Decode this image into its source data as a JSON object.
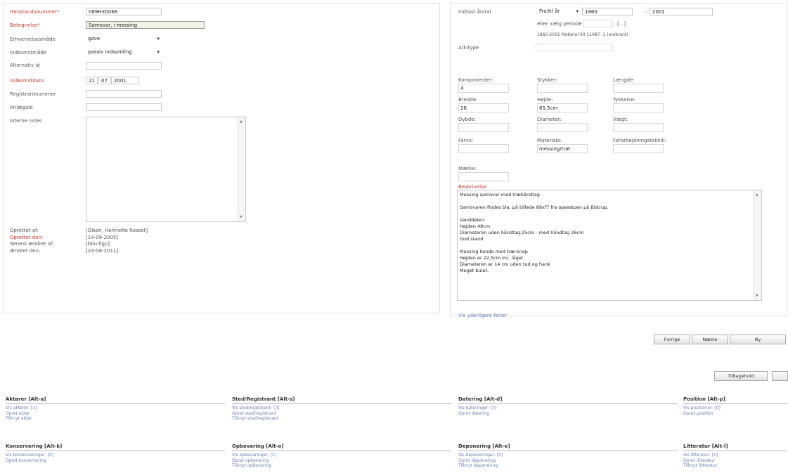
{
  "left": {
    "fields": {
      "genstandsnummer": {
        "label": "Genstandsnummer*",
        "value": "089HX0068"
      },
      "betegnelse": {
        "label": "Betegnelse*",
        "value": "Samovar, i messing"
      },
      "erhvervelsesmade": {
        "label": "Erhvervelsesmåde",
        "value": "gave"
      },
      "indkomstmade": {
        "label": "Indkomstmåde",
        "value": "passiv indsamling"
      },
      "alternativ_id": {
        "label": "Alternativ id",
        "value": ""
      },
      "indkomstdato": {
        "label": "Indkomstdato",
        "day": "21",
        "month": "07",
        "year": "2001"
      },
      "registrantnummer": {
        "label": "Registrantnummer",
        "value": ""
      },
      "anlaegsid": {
        "label": "Anlægsid",
        "value": ""
      },
      "interne_noter": {
        "label": "Interne noter",
        "value": ""
      }
    },
    "meta": [
      {
        "label": "Oprettet af:",
        "value": "[Olsen, Henriette Rosset]",
        "required": false
      },
      {
        "label": "Oprettet den:",
        "value": "[14-09-2005]",
        "required": true
      },
      {
        "label": "Senest ændret af:",
        "value": "[bbu-llgo]",
        "required": false
      },
      {
        "label": "Ændret den:",
        "value": "[24-08-2011]",
        "required": false
      }
    ]
  },
  "right": {
    "indtast_arstal": {
      "label": "Indtast årstal",
      "mode": "Fra/til år",
      "from": "1860",
      "to": "2001",
      "period_text": "eller vælg periode",
      "period_link": "[...]",
      "info": "1860-2001 Materiel 00 11087 -1 (ombrant)"
    },
    "arktype_label": "Arkitype",
    "dims": [
      {
        "label": "Komponenter:",
        "value": "4",
        "required": false
      },
      {
        "label": "Stykker:",
        "value": "",
        "required": false
      },
      {
        "label": "Længde:",
        "value": "",
        "required": true
      },
      {
        "label": "Bredde:",
        "value": "26",
        "required": true
      },
      {
        "label": "Højde:",
        "value": "65,5cm",
        "required": true
      },
      {
        "label": "Tykkelse:",
        "value": "",
        "required": false
      },
      {
        "label": "Dybde:",
        "value": "",
        "required": false
      },
      {
        "label": "Diameter:",
        "value": "",
        "required": false
      },
      {
        "label": "Vægt:",
        "value": "",
        "required": false
      },
      {
        "label": "Farve:",
        "value": "",
        "required": false
      },
      {
        "label": "Materiale:",
        "value": "messing/træ",
        "required": true
      },
      {
        "label": "Forarbejdningsteknik:",
        "value": "",
        "required": false
      },
      {
        "label": "Mærke:",
        "value": "",
        "required": false
      }
    ],
    "beskrivelse_label": "Beskrivelse",
    "beskrivelse_lines": [
      "Messing samovar med træhåndtag",
      "",
      "Samovaren findes bla. på billede 89xf7 fra opsestuen på Bistrup.",
      "",
      "Vanddelen:",
      "Højden 48cm",
      "Diameteren uden håndtag:25cm - med håndtag 26cm",
      "God stand",
      "",
      "Messing kande med træ-knop",
      "Højden er 22,5cm inc. låget",
      "Diameteren er 14 cm uden tud og hank",
      "Meget bulet."
    ],
    "vis_felter": "Vis yderligere felter"
  },
  "nav": {
    "forrige": "Forrige",
    "naeste": "Næste",
    "ny": "Ny"
  },
  "tilbud": "Tilbagehold",
  "sections": [
    {
      "title": "Aktører [Alt-a]",
      "links": [
        "Vis aktører- [3]",
        "Opret aktør",
        "Tilknyt aktør"
      ]
    },
    {
      "title": "Sted/Registrant [Alt-s]",
      "links": [
        "Vis sted/registrant- [3]",
        "Opret sted/registrant",
        "Tilknyt sted/registrant"
      ]
    },
    {
      "title": "Datering [Alt-d]",
      "links": [
        "Vis dateringer- [3]",
        "Opret datering"
      ]
    },
    {
      "title": "Position [Alt-p]",
      "links": [
        "Vis positioner- [0]",
        "Opret position"
      ]
    },
    {
      "title": "Konservering [Alt-k]",
      "links": [
        "Vis konserveringer- [0]",
        "Opret konservering"
      ]
    },
    {
      "title": "Opbevaring [Alt-o]",
      "links": [
        "Vis opbevaringer- [3]",
        "Opret opbevaring",
        "Tilknyt opbevaring"
      ]
    },
    {
      "title": "Deponering [Alt-e]",
      "links": [
        "Vis deponeringer- [0]",
        "Opret deponering",
        "Tilknyt deponering"
      ]
    },
    {
      "title": "Litteratur [Alt-l]",
      "links": [
        "Vis litteratur- [0]",
        "Opret litteratur",
        "Tilknyt litteratur"
      ]
    }
  ]
}
